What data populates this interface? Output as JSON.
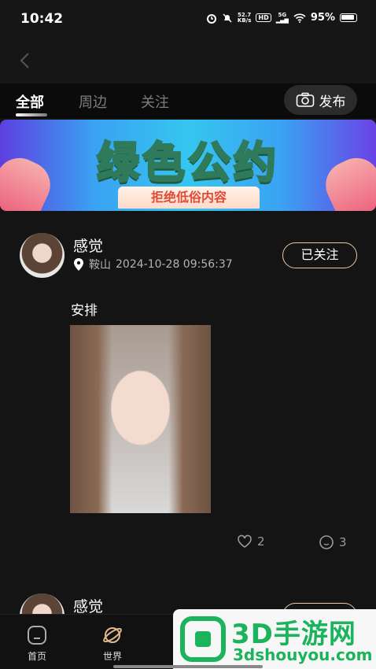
{
  "status": {
    "time": "10:42",
    "net_speed_top": "52.7",
    "net_speed_bottom": "KB/s",
    "hd": "HD",
    "signal": "5G",
    "battery": "95%"
  },
  "tabs": [
    {
      "label": "全部",
      "active": true
    },
    {
      "label": "周边",
      "active": false
    },
    {
      "label": "关注",
      "active": false
    }
  ],
  "publish_label": "发布",
  "banner": {
    "title": "绿色公约",
    "subtitle": "拒绝低俗内容"
  },
  "posts": [
    {
      "username": "感觉",
      "location": "鞍山",
      "timestamp": "2024-10-28 09:56:37",
      "follow_label": "已关注",
      "text": "安排",
      "likes": "2",
      "comments": "3"
    },
    {
      "username": "感觉"
    }
  ],
  "tabbar": [
    {
      "label": "首页",
      "icon": "home-icon"
    },
    {
      "label": "世界",
      "icon": "planet-icon"
    }
  ],
  "watermark": {
    "title": "3D手游网",
    "subtitle": "3dshouyou.com"
  },
  "colors": {
    "accent_border": "#e8c8a0",
    "watermark_green": "#1bb35c",
    "background": "#141414"
  }
}
